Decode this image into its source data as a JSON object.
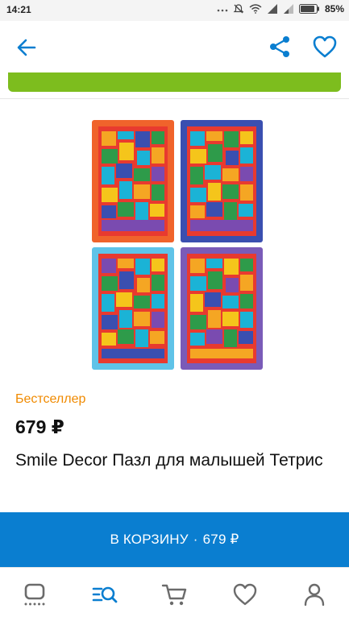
{
  "status_bar": {
    "time": "14:21",
    "battery_percent": "85%",
    "icons": [
      "dots-icon",
      "mute-icon",
      "wifi-icon",
      "signal-icon",
      "signal-icon",
      "battery-icon"
    ]
  },
  "top_bar": {
    "icons": [
      "back-arrow-icon",
      "share-icon",
      "heart-outline-icon"
    ],
    "accent_color": "#0a7ed0"
  },
  "product": {
    "image_icon": "tetris-puzzle-boards-image",
    "badge": "Бестселлер",
    "price": "679 ₽",
    "title": "Smile Decor Пазл для малышей Тетрис"
  },
  "cart_button": {
    "label": "В КОРЗИНУ",
    "separator": "·",
    "price": "679 ₽",
    "color": "#0a7ed0"
  },
  "bottom_nav": {
    "items": [
      "home-icon",
      "catalog-search-icon",
      "cart-icon",
      "favorites-icon",
      "profile-icon"
    ],
    "active": "catalog-search-icon"
  },
  "colors": {
    "green_banner": "#7dbd1e",
    "badge": "#f08a00"
  }
}
